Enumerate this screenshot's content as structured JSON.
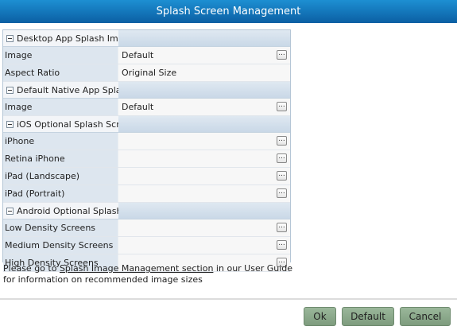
{
  "window": {
    "title": "Splash Screen Management"
  },
  "sections": [
    {
      "title": "Desktop App Splash Image",
      "rows": [
        {
          "label": "Image",
          "value": "Default",
          "has_button": true
        },
        {
          "label": "Aspect Ratio",
          "value": "Original Size",
          "has_button": false
        }
      ]
    },
    {
      "title": "Default Native App Splash In",
      "rows": [
        {
          "label": "Image",
          "value": "Default",
          "has_button": true
        }
      ]
    },
    {
      "title": "iOS Optional Splash Screen",
      "rows": [
        {
          "label": "iPhone",
          "value": "",
          "has_button": true
        },
        {
          "label": "Retina iPhone",
          "value": "",
          "has_button": true
        },
        {
          "label": "iPad (Landscape)",
          "value": "",
          "has_button": true
        },
        {
          "label": "iPad (Portrait)",
          "value": "",
          "has_button": true
        }
      ]
    },
    {
      "title": "Android Optional Splash Scr",
      "rows": [
        {
          "label": "Low Density Screens",
          "value": "",
          "has_button": true
        },
        {
          "label": "Medium Density Screens",
          "value": "",
          "has_button": true
        },
        {
          "label": "High Density Screens",
          "value": "",
          "has_button": true
        }
      ]
    }
  ],
  "browse_button_label": "...",
  "note": {
    "prefix": "Please go to ",
    "link": "Splash Image Management section",
    "suffix": " in our User Guide for information on recommended image sizes"
  },
  "buttons": {
    "ok": "Ok",
    "default": "Default",
    "cancel": "Cancel"
  }
}
